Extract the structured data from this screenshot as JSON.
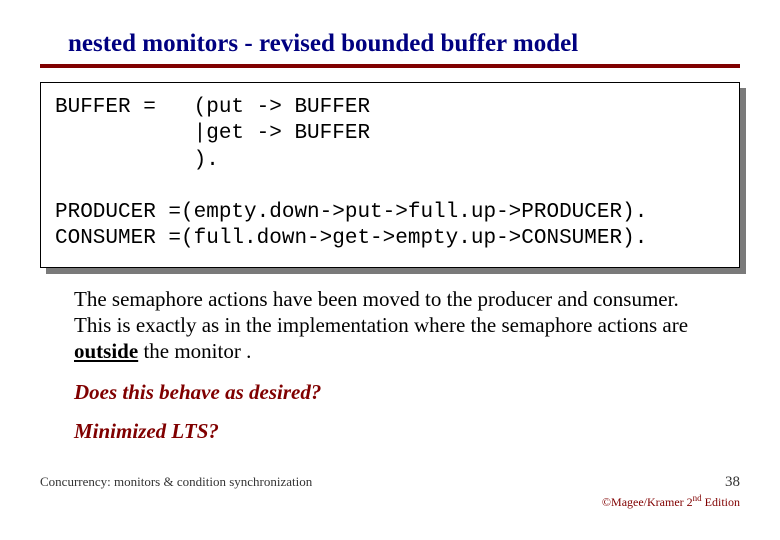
{
  "title": "nested monitors - revised bounded buffer model",
  "code": {
    "l1": "BUFFER =   (put -> BUFFER",
    "l2": "           |get -> BUFFER",
    "l3": "           ).",
    "l4": "",
    "l5": "PRODUCER =(empty.down->put->full.up->PRODUCER).",
    "l6": "CONSUMER =(full.down->get->empty.up->CONSUMER)."
  },
  "para": {
    "t1": "The semaphore actions have been moved to the producer and consumer. This is exactly as in the implementation where the semaphore actions are ",
    "u": "outside",
    "t2": " the monitor ."
  },
  "q1": "Does this behave as desired?",
  "q2": "Minimized LTS?",
  "footer": {
    "left": "Concurrency: monitors & condition synchronization",
    "page": "38",
    "edition_pre": "©Magee/Kramer ",
    "edition_num": "2",
    "edition_sup": "nd",
    "edition_post": " Edition"
  }
}
